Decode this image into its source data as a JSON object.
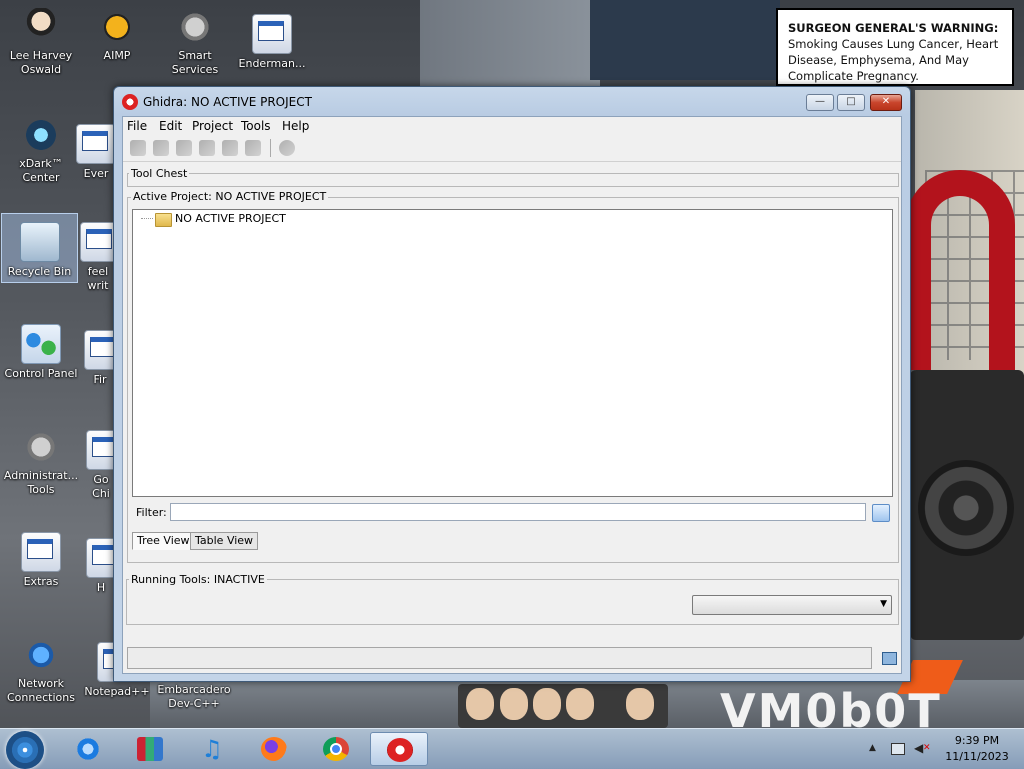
{
  "desktop": {
    "icons": [
      {
        "label": "Lee Harvey Oswald",
        "icon": "person-icon"
      },
      {
        "label": "AIMP",
        "icon": "aimp-icon"
      },
      {
        "label": "Smart Services",
        "icon": "gear-icon"
      },
      {
        "label": "Enderman...",
        "icon": "app-window-icon"
      },
      {
        "label": "xDark™ Center",
        "icon": "xdark-icon"
      },
      {
        "label": "Ever",
        "icon": "app-window-icon"
      },
      {
        "label": "Recycle Bin",
        "icon": "recycle-bin-icon"
      },
      {
        "label": "feel writ",
        "icon": "document-icon"
      },
      {
        "label": "Control Panel",
        "icon": "control-panel-icon"
      },
      {
        "label": "Fir",
        "icon": "app-window-icon"
      },
      {
        "label": "Administrat... Tools",
        "icon": "admin-tools-icon"
      },
      {
        "label": "Go Chi",
        "icon": "app-window-icon"
      },
      {
        "label": "Extras",
        "icon": "folder-icon"
      },
      {
        "label": "H",
        "icon": "app-window-icon"
      },
      {
        "label": "Network Connections",
        "icon": "network-icon"
      },
      {
        "label": "Notepad++",
        "icon": "app-window-icon"
      },
      {
        "label": "Embarcadero Dev-C++",
        "icon": "app-window-icon"
      }
    ],
    "warning": {
      "bold": "SURGEON GENERAL'S WARNING:",
      "text": " Smoking Causes Lung Cancer, Heart Disease, Emphysema, And May Complicate Pregnancy."
    },
    "wallpaper_text": "VM0b0T"
  },
  "window": {
    "title": "Ghidra: NO ACTIVE PROJECT",
    "controls": {
      "minimize": "—",
      "maximize": "□",
      "close": "✕"
    },
    "menu": [
      "File",
      "Edit",
      "Project",
      "Tools",
      "Help"
    ],
    "tool_chest_label": "Tool Chest",
    "active_project_label": "Active Project: NO ACTIVE PROJECT",
    "tree_root": "NO ACTIVE PROJECT",
    "filter_label": "Filter:",
    "filter_value": "",
    "tabs": [
      "Tree View",
      "Table View"
    ],
    "running_tools_label": "Running Tools: INACTIVE",
    "running_tools_selected": "",
    "status_text": ""
  },
  "taskbar": {
    "items": [
      "internet-explorer-icon",
      "archive-icon",
      "music-icon",
      "firefox-icon",
      "chrome-icon",
      "ghidra-icon"
    ],
    "clock_time": "9:39 PM",
    "clock_date": "11/11/2023"
  }
}
